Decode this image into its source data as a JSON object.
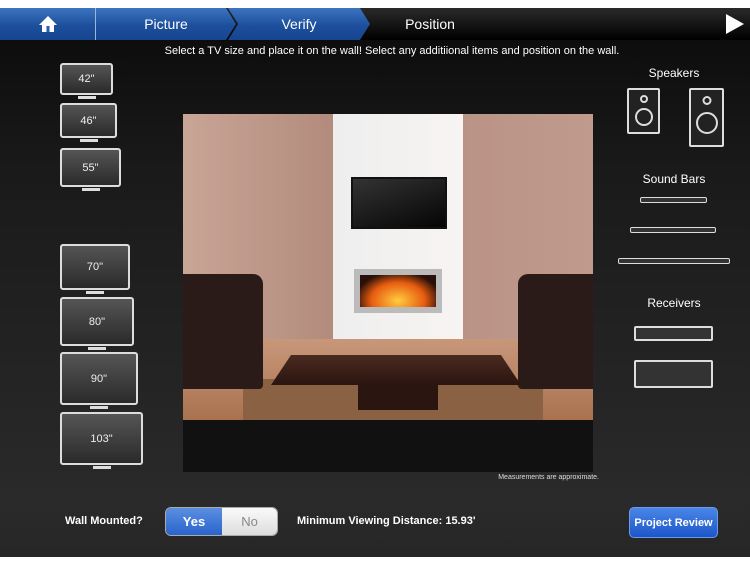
{
  "header": {
    "steps": [
      "Picture",
      "Verify",
      "Position"
    ],
    "active_step": "Position"
  },
  "instruction": "Select a TV size and place it on the wall! Select any additiional items and position on the wall.",
  "tv_sizes": [
    "42\"",
    "46\"",
    "55\"",
    "70\"",
    "80\"",
    "90\"",
    "103\""
  ],
  "accessories": {
    "speakers_label": "Speakers",
    "sound_bars_label": "Sound Bars",
    "receivers_label": "Receivers"
  },
  "measurement_note": "Measurements are approximate.",
  "footer": {
    "wall_mounted_label": "Wall Mounted?",
    "yes": "Yes",
    "no": "No",
    "selected": "Yes",
    "min_distance": "Minimum Viewing Distance: 15.93'",
    "project_review": "Project Review"
  },
  "colors": {
    "accent": "#2a64cc"
  }
}
